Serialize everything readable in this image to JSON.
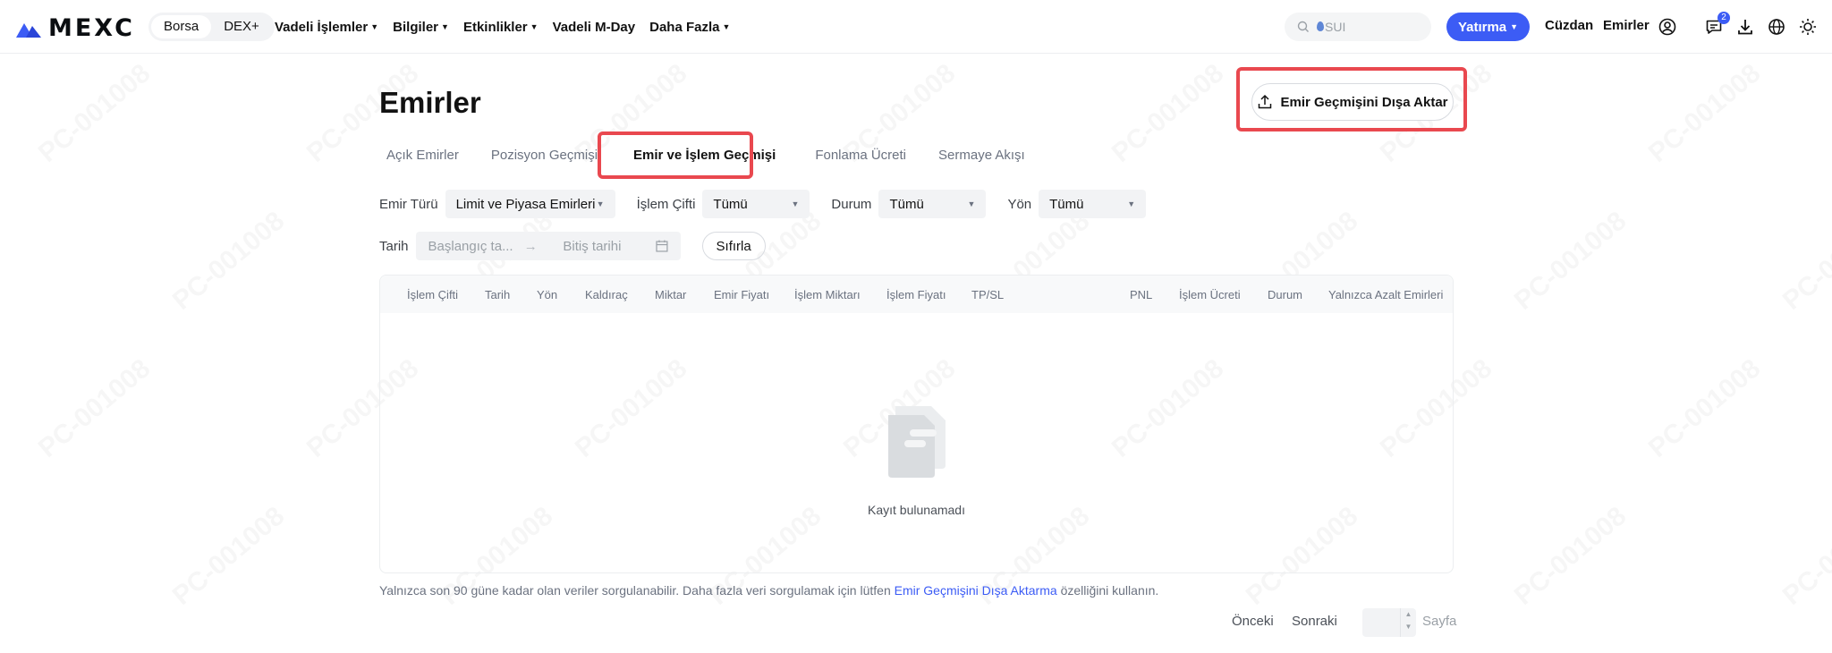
{
  "header": {
    "logo_text": "MEXC",
    "segments": [
      "Borsa",
      "DEX+"
    ],
    "nav": [
      {
        "label": "Vadeli İşlemler",
        "caret": true
      },
      {
        "label": "Bilgiler",
        "caret": true
      },
      {
        "label": "Etkinlikler",
        "caret": true
      },
      {
        "label": "Vadeli M-Day",
        "caret": false
      },
      {
        "label": "Daha Fazla",
        "caret": true
      }
    ],
    "search_placeholder": "SUI",
    "deposit_label": "Yatırma",
    "wallet_label": "Cüzdan",
    "orders_label": "Emirler",
    "notification_count": "2"
  },
  "page": {
    "title": "Emirler",
    "export_label": "Emir Geçmişini Dışa Aktar",
    "tabs": [
      "Açık Emirler",
      "Pozisyon Geçmişi",
      "Emir ve İşlem Geçmişi",
      "Fonlama Ücreti",
      "Sermaye Akışı"
    ],
    "active_tab": "Emir ve İşlem Geçmişi",
    "filters": {
      "order_type_label": "Emir Türü",
      "order_type_value": "Limit ve Piyasa Emirleri",
      "pair_label": "İşlem Çifti",
      "pair_value": "Tümü",
      "status_label": "Durum",
      "status_value": "Tümü",
      "side_label": "Yön",
      "side_value": "Tümü"
    },
    "date": {
      "label": "Tarih",
      "start_placeholder": "Başlangıç ta...",
      "end_placeholder": "Bitiş tarihi",
      "reset_label": "Sıfırla"
    },
    "table": {
      "columns": [
        "İşlem Çifti",
        "Tarih",
        "Yön",
        "Kaldıraç",
        "Miktar",
        "Emir Fiyatı",
        "İşlem Miktarı",
        "İşlem Fiyatı",
        "TP/SL",
        "PNL",
        "İşlem Ücreti",
        "Durum",
        "Yalnızca Azalt Emirleri"
      ],
      "empty_text": "Kayıt bulunamadı"
    },
    "note_before": "Yalnızca son 90 güne kadar olan veriler sorgulanabilir. Daha fazla veri sorgulamak için lütfen",
    "note_link": "Emir Geçmişini Dışa Aktarma",
    "note_after": "özelliğini kullanın.",
    "pagination": {
      "prev_label": "Önceki",
      "next_label": "Sonraki",
      "page_label": "Sayfa"
    }
  },
  "watermark": "PC-001008",
  "colors": {
    "accent": "#3c5cf5",
    "highlight": "#e9484f"
  }
}
